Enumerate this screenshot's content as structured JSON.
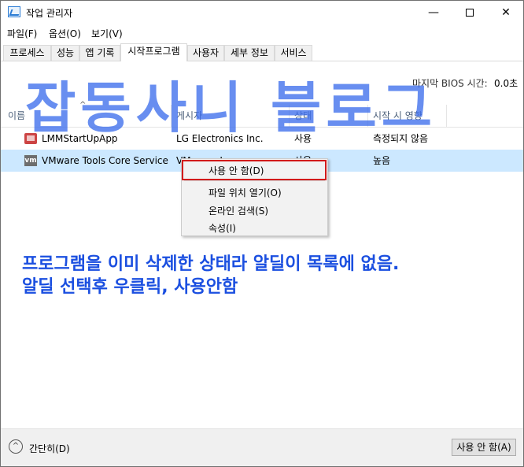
{
  "window": {
    "title": "작업 관리자",
    "minimize_glyph": "—",
    "close_glyph": "✕"
  },
  "menu": {
    "items": [
      "파일(F)",
      "옵션(O)",
      "보기(V)"
    ]
  },
  "tabs": [
    {
      "label": "프로세스"
    },
    {
      "label": "성능"
    },
    {
      "label": "앱 기록"
    },
    {
      "label": "시작프로그램",
      "active": true
    },
    {
      "label": "사용자"
    },
    {
      "label": "세부 정보"
    },
    {
      "label": "서비스"
    }
  ],
  "bios": {
    "label": "마지막 BIOS 시간:",
    "value": "0.0초"
  },
  "watermark": "잡동사니 블로그",
  "columns": {
    "name": "이름",
    "publisher": "게시자",
    "status": "상태",
    "startup_impact": "시작 시 영향",
    "sort_glyph": "^"
  },
  "rows": [
    {
      "icon": "lmm-app-icon",
      "name": "LMMStartUpApp",
      "publisher": "LG Electronics Inc.",
      "status": "사용",
      "impact": "측정되지 않음",
      "selected": false
    },
    {
      "icon": "vmware-icon",
      "icon_text": "vm",
      "name": "VMware Tools Core Service",
      "publisher": "VMware, Inc.",
      "status": "사용",
      "impact": "높음",
      "selected": true
    }
  ],
  "context_menu": {
    "items": [
      "사용 안 함(D)",
      "파일 위치 열기(O)",
      "온라인 검색(S)",
      "속성(I)"
    ],
    "highlight_color": "#d21b1b"
  },
  "annotation": {
    "line1": "프로그램을 이미 삭제한 상태라 알딜이 목록에 없음.",
    "line2": "알딜 선택후 우클릭, 사용안함"
  },
  "footer": {
    "collapse_label": "간단히(D)",
    "collapse_glyph": "^",
    "disable_button": "사용 안 함(A)"
  },
  "colors": {
    "selected_row": "#cce8ff",
    "annotation_text": "#1b4fe0",
    "watermark": "#3e6eec"
  }
}
